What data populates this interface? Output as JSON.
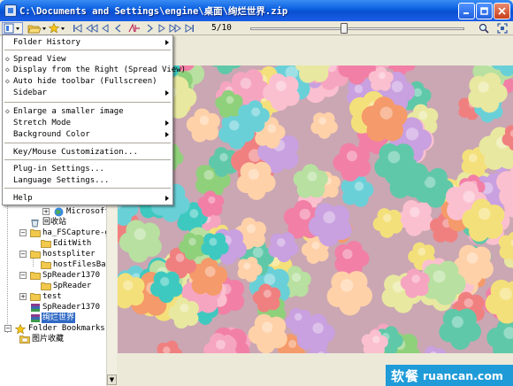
{
  "window": {
    "title": "C:\\Documents and Settings\\engine\\桌面\\绚烂世界.zip"
  },
  "toolbar": {
    "page_indicator": "5/10",
    "slider_position": 0.44
  },
  "menu": {
    "items": [
      {
        "label": "Folder History",
        "submenu": true
      },
      {
        "label": "Spread View",
        "checked": true
      },
      {
        "label": "Display from the Right (Spread View)",
        "checked": true
      },
      {
        "label": "Auto hide toolbar (Fullscreen)",
        "checked": true
      },
      {
        "label": "Sidebar",
        "submenu": true
      },
      {
        "label": "Enlarge a smaller image",
        "checked": true
      },
      {
        "label": "Stretch Mode",
        "submenu": true
      },
      {
        "label": "Background Color",
        "submenu": true
      },
      {
        "label": "Key/Mouse Customization..."
      },
      {
        "label": "Plug-in Settings..."
      },
      {
        "label": "Language Settings..."
      },
      {
        "label": "Help",
        "submenu": true
      }
    ]
  },
  "sidebar": {
    "tree": [
      {
        "label": "Microsoft Wi",
        "icon": "globe-icon"
      },
      {
        "label": "回收站",
        "icon": "recycle-bin-icon"
      },
      {
        "label": "ha_FSCapture-gl",
        "icon": "folder-icon"
      },
      {
        "label": "EditWith",
        "icon": "folder-icon"
      },
      {
        "label": "hostspliter",
        "icon": "folder-icon"
      },
      {
        "label": "hostFilesBak",
        "icon": "folder-icon"
      },
      {
        "label": "SpReader1370",
        "icon": "folder-icon"
      },
      {
        "label": "SpReader",
        "icon": "folder-icon"
      },
      {
        "label": "test",
        "icon": "folder-icon"
      },
      {
        "label": "SpReader1370",
        "icon": "archive-icon"
      },
      {
        "label": "绚烂世界",
        "icon": "archive-icon",
        "selected": true
      },
      {
        "label": "Folder Bookmarks",
        "icon": "star-icon"
      },
      {
        "label": "图片收藏",
        "icon": "bookmark-folder-icon"
      }
    ]
  },
  "watermark": {
    "cn": "软餐",
    "en": "ruancan.com"
  },
  "colors": {
    "titlebar": "#0a5fe0",
    "selection": "#316ac5",
    "watermark": "#1f9bd8"
  }
}
